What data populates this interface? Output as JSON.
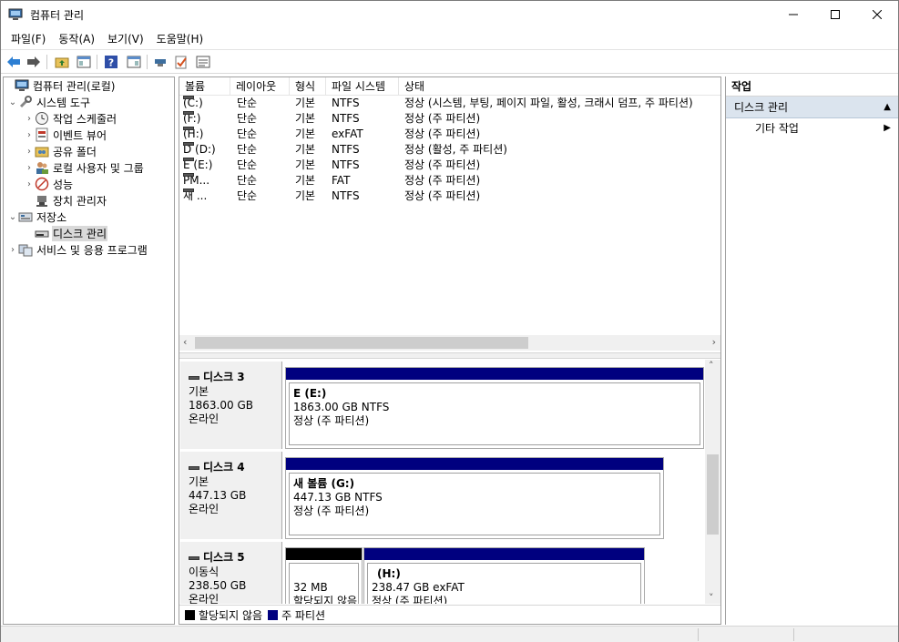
{
  "window": {
    "title": "컴퓨터 관리"
  },
  "menu": [
    "파일(F)",
    "동작(A)",
    "보기(V)",
    "도움말(H)"
  ],
  "tree": {
    "root": "컴퓨터 관리(로컬)",
    "system_tools": "시스템 도구",
    "task_scheduler": "작업 스케줄러",
    "event_viewer": "이벤트 뷰어",
    "shared_folders": "공유 폴더",
    "local_users": "로컬 사용자 및 그룹",
    "performance": "성능",
    "device_manager": "장치 관리자",
    "storage": "저장소",
    "disk_management": "디스크 관리",
    "services": "서비스 및 응용 프로그램"
  },
  "volume_list": {
    "columns": [
      "볼륨",
      "레이아웃",
      "형식",
      "파일 시스템",
      "상태"
    ],
    "rows": [
      {
        "volume": "(C:)",
        "layout": "단순",
        "type": "기본",
        "fs": "NTFS",
        "status": "정상 (시스템, 부팅, 페이지 파일, 활성, 크래시 덤프, 주 파티션)"
      },
      {
        "volume": "(F:)",
        "layout": "단순",
        "type": "기본",
        "fs": "NTFS",
        "status": "정상 (주 파티션)"
      },
      {
        "volume": "(H:)",
        "layout": "단순",
        "type": "기본",
        "fs": "exFAT",
        "status": "정상 (주 파티션)"
      },
      {
        "volume": "D (D:)",
        "layout": "단순",
        "type": "기본",
        "fs": "NTFS",
        "status": "정상 (활성, 주 파티션)"
      },
      {
        "volume": "E (E:)",
        "layout": "단순",
        "type": "기본",
        "fs": "NTFS",
        "status": "정상 (주 파티션)"
      },
      {
        "volume": "PM...",
        "layout": "단순",
        "type": "기본",
        "fs": "FAT",
        "status": "정상 (주 파티션)"
      },
      {
        "volume": "새 ...",
        "layout": "단순",
        "type": "기본",
        "fs": "NTFS",
        "status": "정상 (주 파티션)"
      }
    ]
  },
  "disks": [
    {
      "name": "디스크 3",
      "kind": "기본",
      "size": "1863.00 GB",
      "state": "온라인",
      "partitions": [
        {
          "label": "E  (E:)",
          "size": "1863.00 GB NTFS",
          "status": "정상 (주 파티션)"
        }
      ]
    },
    {
      "name": "디스크 4",
      "kind": "기본",
      "size": "447.13 GB",
      "state": "온라인",
      "partitions": [
        {
          "label": "새 볼륨  (G:)",
          "size": "447.13 GB NTFS",
          "status": "정상 (주 파티션)"
        }
      ]
    },
    {
      "name": "디스크 5",
      "kind": "이동식",
      "size": "238.50 GB",
      "state": "온라인",
      "partitions": [
        {
          "label": "",
          "size": "32 MB",
          "status": "할당되지 않음"
        },
        {
          "label": "(H:)",
          "size": "238.47 GB exFAT",
          "status": "정상 (주 파티션)"
        }
      ]
    }
  ],
  "legend": {
    "unallocated": "할당되지 않음",
    "primary": "주 파티션"
  },
  "actions": {
    "header": "작업",
    "section": "디스크 관리",
    "item": "기타 작업"
  },
  "colors": {
    "primary": "#00007f",
    "unallocated": "#000000",
    "selection": "#d9d9d9",
    "action_section": "#dbe4ee"
  }
}
